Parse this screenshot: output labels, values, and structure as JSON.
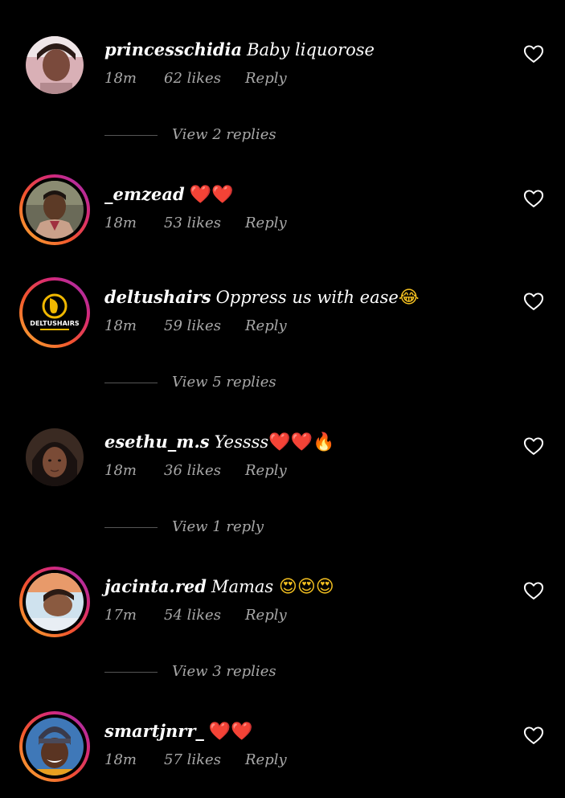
{
  "comments": [
    {
      "username": "princesschidia",
      "text": "Baby liquorose",
      "emoji": "",
      "time": "18m",
      "likes": "62 likes",
      "reply": "Reply",
      "story_ring": false,
      "view_replies": "View 2 replies"
    },
    {
      "username": "_emzead",
      "text": "",
      "emoji": "❤️❤️",
      "time": "18m",
      "likes": "53 likes",
      "reply": "Reply",
      "story_ring": true,
      "view_replies": ""
    },
    {
      "username": "deltushairs",
      "text": "Oppress us with ease",
      "emoji": "😂",
      "time": "18m",
      "likes": "59 likes",
      "reply": "Reply",
      "story_ring": true,
      "view_replies": "View 5 replies"
    },
    {
      "username": "esethu_m.s",
      "text": "Yessss",
      "emoji": "❤️❤️🔥",
      "time": "18m",
      "likes": "36 likes",
      "reply": "Reply",
      "story_ring": false,
      "view_replies": "View 1 reply"
    },
    {
      "username": "jacinta.red",
      "text": "Mamas",
      "emoji": "😍😍😍",
      "time": "17m",
      "likes": "54 likes",
      "reply": "Reply",
      "story_ring": true,
      "view_replies": "View 3 replies"
    },
    {
      "username": "smartjnrr_",
      "text": "",
      "emoji": "❤️❤️",
      "time": "18m",
      "likes": "57 likes",
      "reply": "Reply",
      "story_ring": true,
      "view_replies": ""
    }
  ],
  "deltus_logo_text": "DELTUSHAIRS",
  "colors": {
    "background": "#000000",
    "secondary_text": "#a8a8a8",
    "heart_red": "#e0242b",
    "story_ring_start": "#f9b233",
    "story_ring_end": "#962fbf"
  },
  "icons": {
    "like": "heart-outline-icon"
  }
}
